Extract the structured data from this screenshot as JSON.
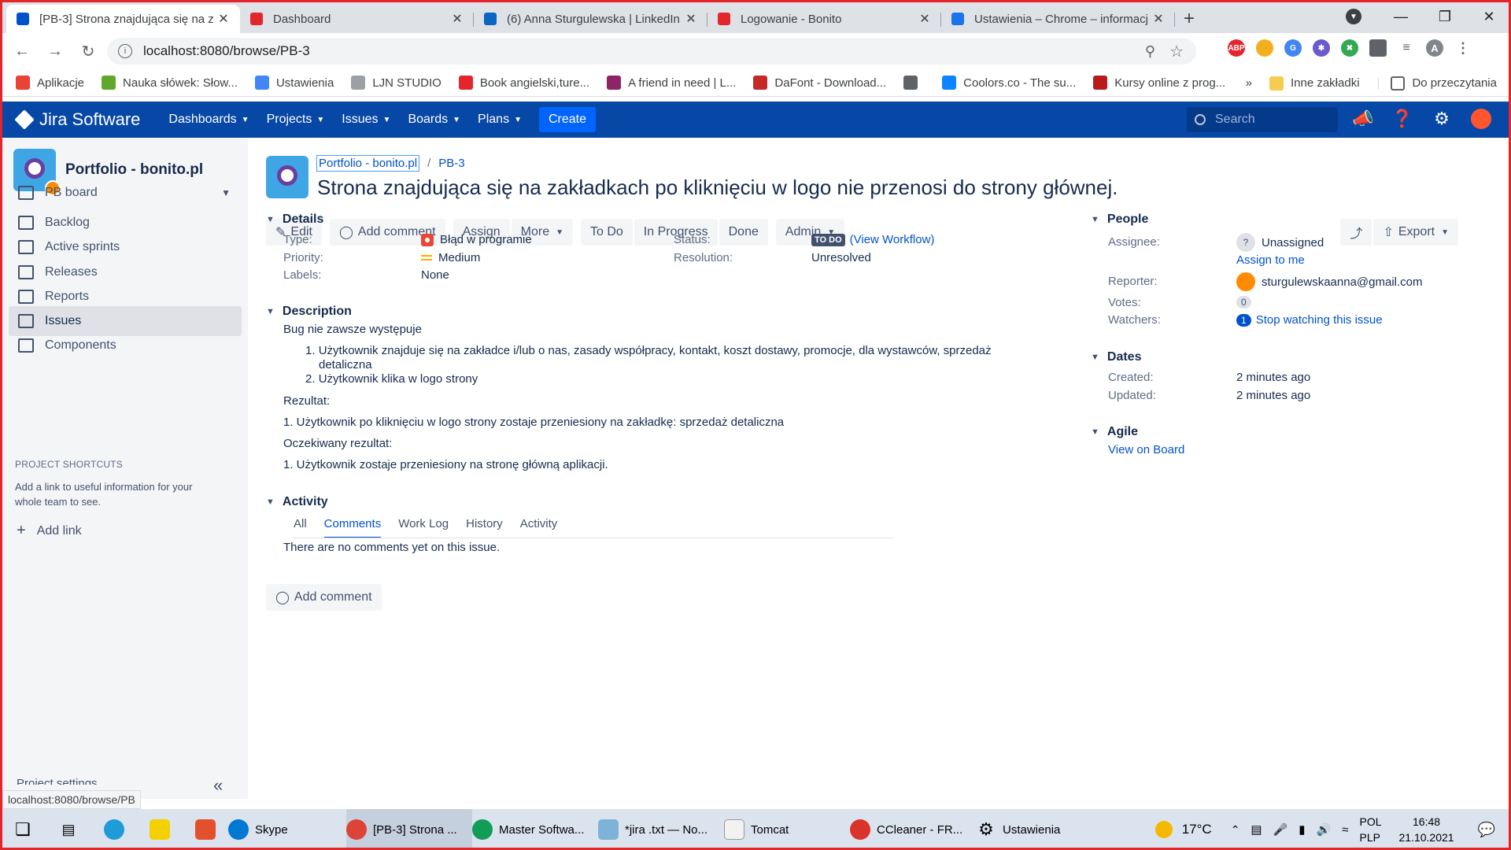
{
  "browser": {
    "tabs": [
      {
        "title": "[PB-3] Strona znajdująca się na z",
        "color": "#0052cc",
        "active": true
      },
      {
        "title": "Dashboard",
        "color": "#e4262c",
        "active": false
      },
      {
        "title": "(6) Anna Sturgulewska | LinkedIn",
        "color": "#0a66c2",
        "active": false
      },
      {
        "title": "Logowanie - Bonito",
        "color": "#e4262c",
        "active": false
      },
      {
        "title": "Ustawienia – Chrome – informacj",
        "color": "#1a73e8",
        "active": false
      }
    ],
    "url": "localhost:8080/browse/PB-3",
    "profile_initial": "A",
    "bookmarks": [
      {
        "label": "Aplikacje",
        "color": "#ea4335"
      },
      {
        "label": "Nauka słówek: Słow...",
        "color": "#5fa82b"
      },
      {
        "label": "Ustawienia",
        "color": "#4285f4"
      },
      {
        "label": "LJN STUDIO",
        "color": "#9aa0a6"
      },
      {
        "label": "Book angielski,ture...",
        "color": "#e4262c"
      },
      {
        "label": "A friend in need | L...",
        "color": "#8e2466"
      },
      {
        "label": "DaFont - Download...",
        "color": "#c62828"
      },
      {
        "label": "",
        "color": "#5f6368"
      },
      {
        "label": "Coolors.co - The su...",
        "color": "#0a84ff"
      },
      {
        "label": "Kursy online z prog...",
        "color": "#b71c1c"
      }
    ],
    "bookmarks_more": "»",
    "bookmark_folder_1": "Inne zakładki",
    "bookmark_folder_2": "Do przeczytania",
    "status_url": "localhost:8080/browse/PB"
  },
  "jira": {
    "product": "Jira Software",
    "menu": [
      "Dashboards",
      "Projects",
      "Issues",
      "Boards",
      "Plans"
    ],
    "create": "Create",
    "search_placeholder": "Search"
  },
  "sidebar": {
    "project_name": "Portfolio - bonito.pl",
    "board": "PB board",
    "items": [
      "Backlog",
      "Active sprints",
      "Releases",
      "Reports",
      "Issues",
      "Components"
    ],
    "selected": "Issues",
    "shortcuts_title": "PROJECT SHORTCUTS",
    "shortcuts_text": "Add a link to useful information for your whole team to see.",
    "add_link": "Add link",
    "settings": "Project settings"
  },
  "issue": {
    "breadcrumb_project": "Portfolio - bonito.pl",
    "key": "PB-3",
    "title": "Strona znajdująca się na zakładkach po kliknięciu w logo nie przenosi do strony głównej.",
    "actions": {
      "edit": "Edit",
      "add_comment": "Add comment",
      "assign": "Assign",
      "more": "More",
      "todo": "To Do",
      "in_progress": "In Progress",
      "done": "Done",
      "admin": "Admin",
      "export": "Export"
    },
    "details": {
      "title": "Details",
      "type_label": "Type:",
      "type": "Błąd w programie",
      "priority_label": "Priority:",
      "priority": "Medium",
      "labels_label": "Labels:",
      "labels": "None",
      "status_label": "Status:",
      "status": "TO DO",
      "workflow": "(View Workflow)",
      "resolution_label": "Resolution:",
      "resolution": "Unresolved"
    },
    "description": {
      "title": "Description",
      "intro": "Bug nie zawsze występuje",
      "steps": [
        "Użytkownik znajduje się na zakładce i/lub o nas, zasady współpracy, kontakt, koszt dostawy, promocje, dla wystawców, sprzedaż",
        "detaliczna",
        "Użytkownik klika w logo strony"
      ],
      "result_label": "Rezultat:",
      "result": "1. Użytkownik po kliknięciu w logo strony zostaje przeniesiony na zakładkę: sprzedaż detaliczna",
      "expected_label": "Oczekiwany rezultat:",
      "expected": "1. Użytkownik zostaje przeniesiony na stronę główną aplikacji."
    },
    "activity": {
      "title": "Activity",
      "tabs": [
        "All",
        "Comments",
        "Work Log",
        "History",
        "Activity"
      ],
      "active_tab": "Comments",
      "empty": "There are no comments yet on this issue.",
      "add_comment": "Add comment"
    },
    "people": {
      "title": "People",
      "assignee_label": "Assignee:",
      "assignee": "Unassigned",
      "assign_me": "Assign to me",
      "reporter_label": "Reporter:",
      "reporter": "sturgulewskaanna@gmail.com",
      "votes_label": "Votes:",
      "votes": "0",
      "watchers_label": "Watchers:",
      "watchers": "1",
      "watch_link": "Stop watching this issue"
    },
    "dates": {
      "title": "Dates",
      "created_label": "Created:",
      "created": "2 minutes ago",
      "updated_label": "Updated:",
      "updated": "2 minutes ago"
    },
    "agile": {
      "title": "Agile",
      "link": "View on Board"
    }
  },
  "taskbar": {
    "apps": [
      "Skype",
      "[PB-3] Strona ...",
      "Master Softwa...",
      "*jira .txt — No...",
      "Tomcat",
      "CCleaner - FR...",
      "Ustawienia"
    ],
    "temp": "17°C",
    "lang1": "POL",
    "lang2": "PLP",
    "time": "16:48",
    "date": "21.10.2021"
  }
}
